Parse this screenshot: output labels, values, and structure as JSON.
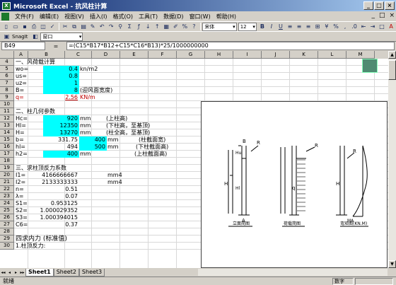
{
  "window": {
    "title": "Microsoft Excel - 抗风柱计算",
    "icon_label": "X",
    "minimize": "_",
    "maximize": "□",
    "close": "×"
  },
  "menu": {
    "items": [
      "文件(F)",
      "编辑(E)",
      "视图(V)",
      "插入(I)",
      "格式(O)",
      "工具(T)",
      "数据(D)",
      "窗口(W)",
      "帮助(H)"
    ],
    "doc_min": "_",
    "doc_restore": "□",
    "doc_close": "×"
  },
  "toolbar1": {
    "icons": [
      "new-icon",
      "open-icon",
      "save-icon",
      "print-icon",
      "preview-icon",
      "spell-icon",
      "cut-icon",
      "copy-icon",
      "paste-icon",
      "format-painter-icon",
      "undo-icon",
      "redo-icon",
      "hyperlink-icon",
      "autosum-icon",
      "function-icon",
      "sort-asc-icon",
      "sort-desc-icon",
      "chart-wizard-icon",
      "drawing-icon",
      "zoom-icon",
      "help-icon"
    ],
    "glyphs": [
      "▯",
      "▭",
      "▪",
      "⎙",
      "◫",
      "✓",
      "✂",
      "⧉",
      "▤",
      "✎",
      "↶",
      "↷",
      "⚲",
      "Σ",
      "ƒ",
      "↓",
      "↑",
      "▦",
      "✐",
      "%",
      "?"
    ],
    "font": "宋体",
    "size": "12",
    "format_glyphs": [
      "B",
      "I",
      "U",
      "≡",
      "≡",
      "≡",
      "⊞",
      "¥",
      "%",
      ",",
      ".0",
      "⇤",
      "⇥",
      "□",
      "A"
    ]
  },
  "toolbar2": {
    "snagit": "SnagIt",
    "window_combo": "窗口"
  },
  "formula_bar": {
    "name_box": "B49",
    "fx": "=",
    "formula": "=(C15*B17*B12+C15*C16*B13)*25/1000000000"
  },
  "columns": [
    "A",
    "B",
    "C",
    "D",
    "E",
    "F",
    "G",
    "H",
    "I",
    "J",
    "K",
    "L",
    "M"
  ],
  "rows": [
    "4",
    "5",
    "6",
    "7",
    "8",
    "9",
    "10",
    "11",
    "12",
    "13",
    "14",
    "15",
    "16",
    "17",
    "18",
    "19",
    "20",
    "21",
    "22",
    "23",
    "24",
    "25",
    "26",
    "27",
    "28",
    "29",
    "30"
  ],
  "cells": {
    "r4a": "一、风荷载计算",
    "r5a": "wo=",
    "r5b": "0.4",
    "r5c": "kn/m2",
    "r6a": "us=",
    "r6b": "0.8",
    "r7a": "uz=",
    "r7b": "1",
    "r8a": "B=",
    "r8b": "8",
    "r8c": "(迎风面宽度)",
    "r9a": "q=",
    "r9b": "2.56",
    "r9c": "KN/m",
    "r11a": "二、柱几何参数",
    "r12a": "Hc=",
    "r12b": "920",
    "r12c": "mm",
    "r12d": "(上柱高)",
    "r13a": "Hl=",
    "r13b": "12350",
    "r13c": "mm",
    "r13d": "(下柱高，至基顶)",
    "r14a": "H=",
    "r14b": "13270",
    "r14c": "mm",
    "r14d": "(柱全高，至基顶)",
    "r15a": "b=",
    "r15b": "331.75",
    "r15c": "400",
    "r15d": "mm",
    "r15e": "(柱截面宽)",
    "r16a": "hl=",
    "r16b": "494",
    "r16c": "500",
    "r16d": "mm",
    "r16e": "(下柱截面高)",
    "r17a": "h2=",
    "r17b": "400",
    "r17c": "mm",
    "r17d": "(上柱截面高)",
    "r19a": "三、求柱顶反力系数",
    "r20a": "I1=",
    "r20b": "4166666667",
    "r20d": "mm4",
    "r21a": "I2=",
    "r21b": "2133333333",
    "r21d": "mm4",
    "r22a": "n=",
    "r22b": "0.51",
    "r23a": "λ=",
    "r23b": "0.07",
    "r24a": "S1=",
    "r24b": "0.953125",
    "r25a": "S2=",
    "r25b": "1.000029352",
    "r26a": "S3=",
    "r26b": "1.000394015",
    "r27a": "C6=",
    "r27b": "0.37",
    "r29a": "四求内力 (标准值)",
    "r30a": "1.柱顶反力:"
  },
  "drawing_labels": {
    "d1": "立面简图",
    "d2": "荷载简图",
    "d3": "弯矩图(KN.M)",
    "b": "B",
    "r": "R",
    "a": "A",
    "h": "H",
    "hu": "Hu",
    "hl": "Hl",
    "q": "q",
    "ma": "MA"
  },
  "sheet_tabs": [
    "Sheet1",
    "Sheet2",
    "Sheet3"
  ],
  "tab_nav": [
    "◂◂",
    "◂",
    "▸",
    "▸▸"
  ],
  "status": {
    "text": "就绪",
    "num": "数字"
  }
}
